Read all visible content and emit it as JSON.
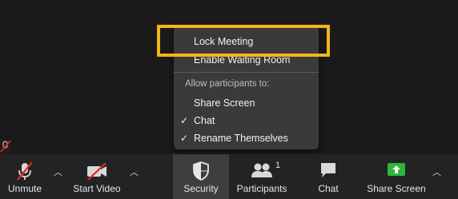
{
  "menu": {
    "items": [
      {
        "label": "Lock Meeting",
        "checked": false
      },
      {
        "label": "Enable Waiting Room",
        "checked": false
      }
    ],
    "heading": "Allow participants to:",
    "permissions": [
      {
        "label": "Share Screen",
        "checked": false
      },
      {
        "label": "Chat",
        "checked": true
      },
      {
        "label": "Rename Themselves",
        "checked": true
      }
    ]
  },
  "toolbar": {
    "unmute": "Unmute",
    "start_video": "Start Video",
    "security": "Security",
    "participants": "Participants",
    "participants_count": "1",
    "chat": "Chat",
    "share_screen": "Share Screen"
  },
  "icons": {
    "mic": "mic-muted-icon",
    "video": "video-off-icon",
    "security": "shield-icon",
    "participants": "people-icon",
    "chat": "chat-bubble-icon",
    "share": "share-screen-icon"
  },
  "colors": {
    "highlight": "#f3b51a",
    "share_green": "#2fb53a",
    "muted_red": "#e02828"
  },
  "check_glyph": "✓"
}
